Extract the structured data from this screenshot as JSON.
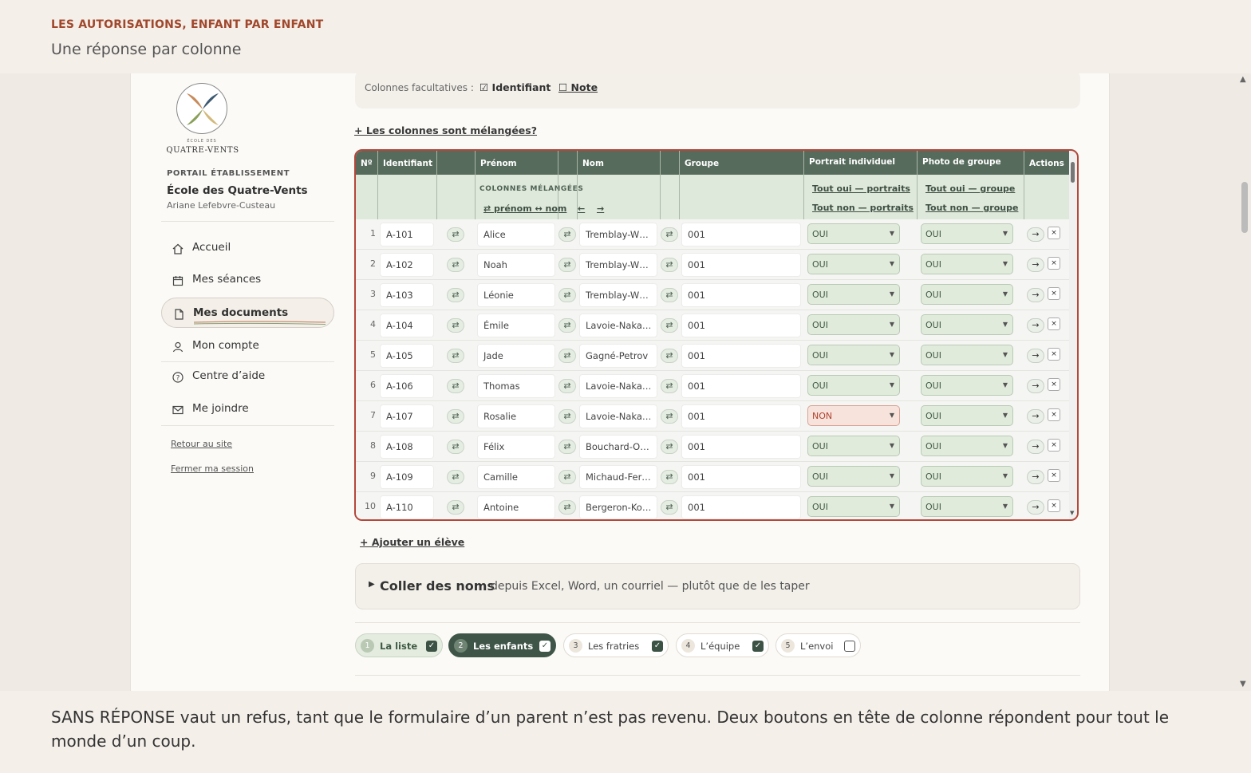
{
  "banner": {
    "kicker": "LES AUTORISATIONS, ENFANT PAR ENFANT",
    "subtitle": "Une réponse par colonne",
    "footer": "SANS RÉPONSE vaut un refus, tant que le formulaire d’un parent n’est pas revenu. Deux boutons en tête de colonne répondent pour tout le monde d’un coup."
  },
  "sidebar": {
    "logo_small": "ÉCOLE DES",
    "logo_name": "QUATRE-VENTS",
    "portal_label": "PORTAIL ÉTABLISSEMENT",
    "school_name": "École des Quatre-Vents",
    "user_name": "Ariane Lefebvre-Custeau",
    "nav": [
      {
        "label": "Accueil",
        "icon": "home-icon"
      },
      {
        "label": "Mes séances",
        "icon": "calendar-icon"
      },
      {
        "label": "Mes documents",
        "icon": "document-icon",
        "active": true
      },
      {
        "label": "Mon compte",
        "icon": "user-icon"
      },
      {
        "label": "Centre d’aide",
        "icon": "help-icon"
      },
      {
        "label": "Me joindre",
        "icon": "mail-icon"
      }
    ],
    "back_link": "Retour au site",
    "logout_link": "Fermer ma session"
  },
  "options": {
    "label": "Colonnes facultatives :",
    "identifier": "☑ Identifiant",
    "note": "☐ Note"
  },
  "mixed_link": "+ Les colonnes sont mélangées?",
  "table": {
    "headers": {
      "num": "Nº",
      "id": "Identifiant",
      "first": "Prénom",
      "last": "Nom",
      "group": "Groupe",
      "portrait": "Portrait individuel",
      "photo": "Photo de groupe",
      "actions": "Actions"
    },
    "mixed_label": "COLONNES MÉLANGÉES",
    "swap_names": "⇄ prénom ↔ nom",
    "shift_left": "←",
    "shift_right": "→",
    "portrait_all_yes": "Tout oui — portraits",
    "portrait_all_no": "Tout non — portraits",
    "photo_all_yes": "Tout oui — groupe",
    "photo_all_no": "Tout non — groupe",
    "swap_glyph": "⇄",
    "go_glyph": "→",
    "delete_glyph": "×",
    "rows": [
      {
        "n": "1",
        "id": "A-101",
        "first": "Alice",
        "last": "Tremblay-W…",
        "group": "001",
        "portrait": "OUI",
        "photo": "OUI"
      },
      {
        "n": "2",
        "id": "A-102",
        "first": "Noah",
        "last": "Tremblay-W…",
        "group": "001",
        "portrait": "OUI",
        "photo": "OUI"
      },
      {
        "n": "3",
        "id": "A-103",
        "first": "Léonie",
        "last": "Tremblay-W…",
        "group": "001",
        "portrait": "OUI",
        "photo": "OUI"
      },
      {
        "n": "4",
        "id": "A-104",
        "first": "Émile",
        "last": "Lavoie-Naka…",
        "group": "001",
        "portrait": "OUI",
        "photo": "OUI"
      },
      {
        "n": "5",
        "id": "A-105",
        "first": "Jade",
        "last": "Gagné-Petrov",
        "group": "001",
        "portrait": "OUI",
        "photo": "OUI"
      },
      {
        "n": "6",
        "id": "A-106",
        "first": "Thomas",
        "last": "Lavoie-Naka…",
        "group": "001",
        "portrait": "OUI",
        "photo": "OUI"
      },
      {
        "n": "7",
        "id": "A-107",
        "first": "Rosalie",
        "last": "Lavoie-Naka…",
        "group": "001",
        "portrait": "NON",
        "photo": "OUI"
      },
      {
        "n": "8",
        "id": "A-108",
        "first": "Félix",
        "last": "Bouchard-O…",
        "group": "001",
        "portrait": "OUI",
        "photo": "OUI"
      },
      {
        "n": "9",
        "id": "A-109",
        "first": "Camille",
        "last": "Michaud-Fer…",
        "group": "001",
        "portrait": "OUI",
        "photo": "OUI"
      },
      {
        "n": "10",
        "id": "A-110",
        "first": "Antoine",
        "last": "Bergeron-Ko…",
        "group": "001",
        "portrait": "OUI",
        "photo": "OUI"
      }
    ]
  },
  "add_student": "+ Ajouter un élève",
  "paste": {
    "strong": "Coller des noms",
    "rest": "depuis Excel, Word, un courriel — plutôt que de les taper"
  },
  "steps": [
    {
      "n": "1",
      "label": "La liste",
      "checked": true,
      "state": "done"
    },
    {
      "n": "2",
      "label": "Les enfants",
      "checked": true,
      "state": "current"
    },
    {
      "n": "3",
      "label": "Les fratries",
      "checked": true,
      "state": "todo"
    },
    {
      "n": "4",
      "label": "L’équipe",
      "checked": true,
      "state": "todo"
    },
    {
      "n": "5",
      "label": "L’envoi",
      "checked": false,
      "state": "todo"
    }
  ],
  "colors": {
    "accent": "#a0472c",
    "header_green": "#566b5c",
    "sub_green": "#dfe9db",
    "table_border": "#b4463a",
    "no_red": "#b0432f"
  }
}
